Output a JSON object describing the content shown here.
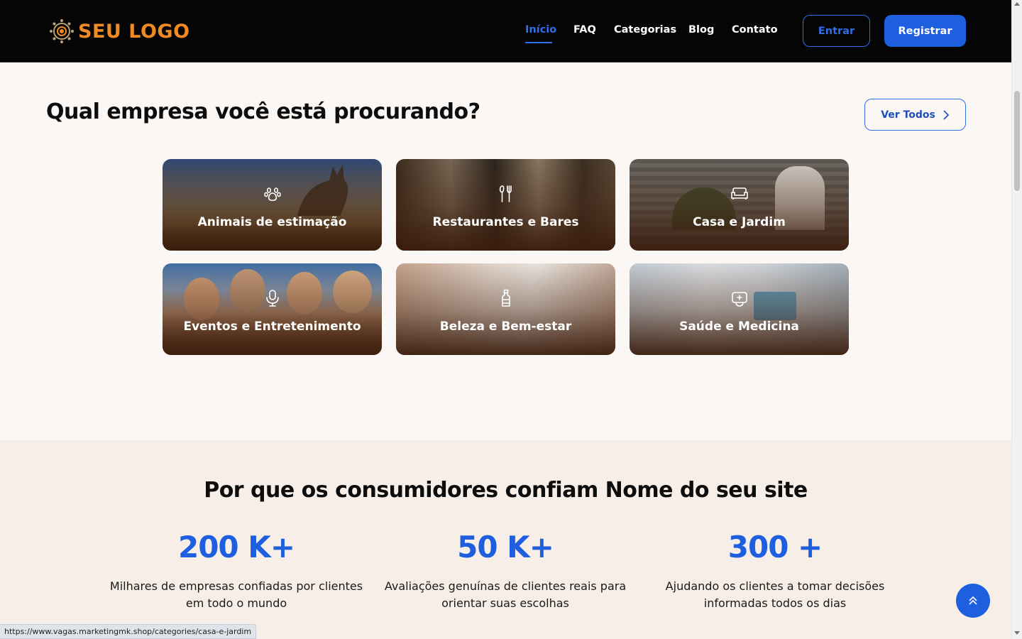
{
  "header": {
    "logo_text": "SEU LOGO",
    "nav": [
      {
        "label": "Início",
        "active": true
      },
      {
        "label": "FAQ",
        "active": false
      },
      {
        "label": "Categorias",
        "active": false
      },
      {
        "label": "Blog",
        "active": false
      },
      {
        "label": "Contato",
        "active": false
      }
    ],
    "login_label": "Entrar",
    "register_label": "Registrar"
  },
  "categories": {
    "title": "Qual empresa você está procurando?",
    "view_all_label": "Ver Todos",
    "items": [
      {
        "label": "Animais de estimação",
        "icon": "paw-icon"
      },
      {
        "label": "Restaurantes e Bares",
        "icon": "fork-knife-icon"
      },
      {
        "label": "Casa e Jardim",
        "icon": "sofa-icon"
      },
      {
        "label": "Eventos e Entretenimento",
        "icon": "microphone-icon"
      },
      {
        "label": "Beleza e Bem-estar",
        "icon": "bottle-icon"
      },
      {
        "label": "Saúde e Medicina",
        "icon": "medical-kit-icon"
      }
    ]
  },
  "trust": {
    "title": "Por que os consumidores confiam Nome do seu site",
    "stats": [
      {
        "value": "200 K+",
        "description_line1": "Milhares de empresas confiadas por clientes",
        "description_line2": "em todo o mundo"
      },
      {
        "value": "50 K+",
        "description_line1": "Avaliações genuínas de clientes reais para",
        "description_line2": "orientar suas escolhas"
      },
      {
        "value": "300 +",
        "description_line1": "Ajudando os clientes a tomar decisões",
        "description_line2": "informadas todos os dias"
      }
    ]
  },
  "status_bar": {
    "url": "https://www.vagas.marketingmk.shop/categories/casa-e-jardim"
  },
  "colors": {
    "accent": "#1e5fe0",
    "logo": "#f08a24",
    "header_bg": "#050505",
    "page_bg": "#faf7f4",
    "trust_bg": "#f6eee7"
  }
}
